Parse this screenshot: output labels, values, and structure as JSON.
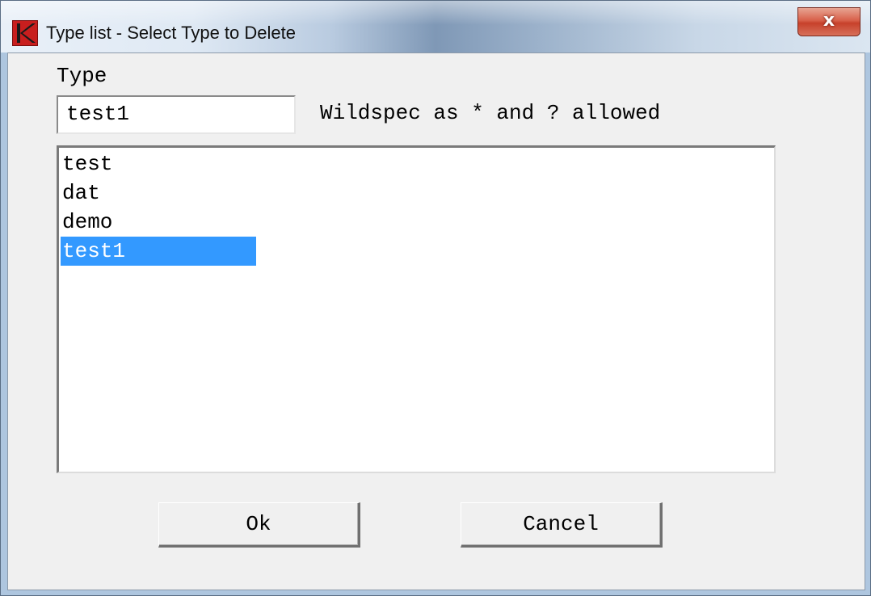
{
  "window": {
    "title": "Type list - Select Type to Delete",
    "close_glyph": "x"
  },
  "form": {
    "type_label": "Type",
    "type_value": "test1",
    "hint": "Wildspec as * and ? allowed"
  },
  "list": {
    "items": [
      "test",
      "dat",
      "demo",
      "test1"
    ],
    "selected_index": 3
  },
  "buttons": {
    "ok": "Ok",
    "cancel": "Cancel"
  },
  "colors": {
    "selection": "#3399ff",
    "close_button": "#c7412b",
    "app_icon": "#c81e1e"
  },
  "icons": {
    "app": "k-logo-icon",
    "close": "close-icon"
  }
}
